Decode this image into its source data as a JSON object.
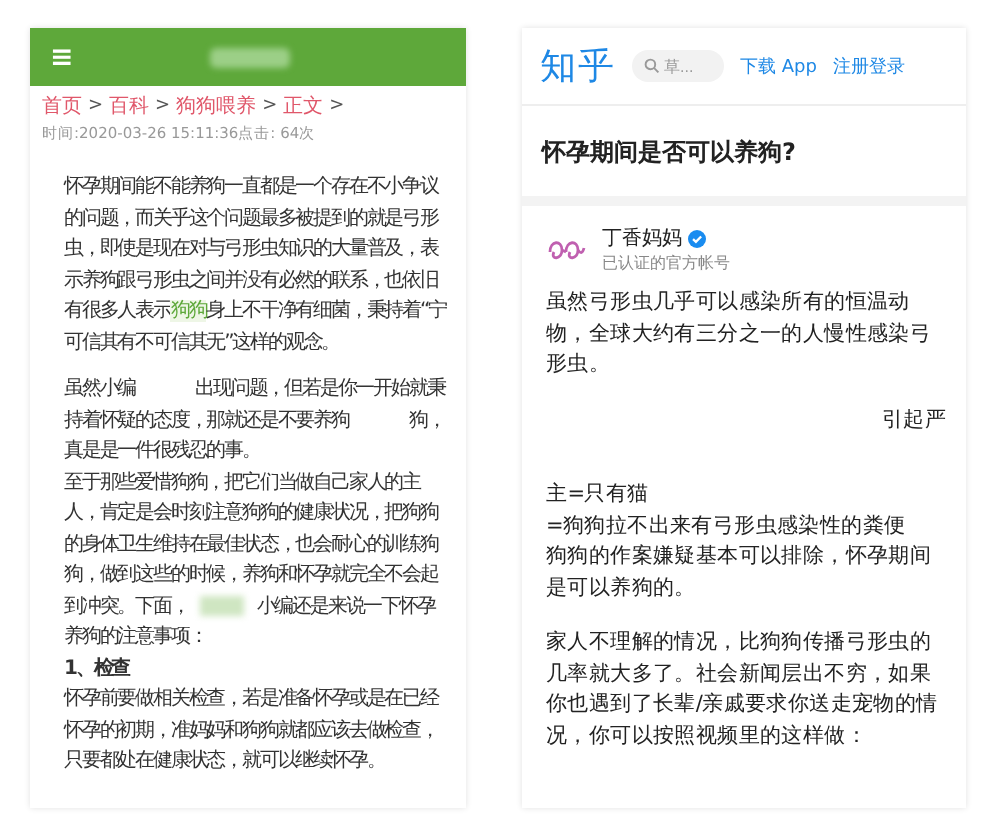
{
  "left_page": {
    "header": {
      "menu_icon": "≡"
    },
    "breadcrumb": [
      "首页",
      "百科",
      "狗狗喂养",
      "正文"
    ],
    "separator": ">",
    "meta": "时间:2020-03-26 15:11:36点击: 64次",
    "paragraphs": [
      {
        "kind": "text",
        "segments": [
          {
            "kind": "plain",
            "text": "怀孕期间能不能养狗一直都是一个存在不小争议的问题，而关乎这个问题最多被提到的就是弓形虫，即使是现在对与弓形虫知识的大量普及，表示养狗跟弓形虫之间并没有必然的联系，也依旧有很多人表示"
          },
          {
            "kind": "link",
            "text": "狗狗"
          },
          {
            "kind": "plain",
            "text": "身上不干净有细菌，秉持着“宁可信其有不可信其无”这样的观念。"
          }
        ]
      },
      {
        "kind": "tight",
        "segments": [
          {
            "kind": "plain",
            "text": "虽然小编"
          },
          {
            "kind": "gap"
          },
          {
            "kind": "plain",
            "text": "出现问题，但若是你一开始就秉持着怀疑的态度，那就还是不要养狗"
          },
          {
            "kind": "gap"
          },
          {
            "kind": "plain",
            "text": "狗，真是是一件很残忍的事。"
          }
        ]
      },
      {
        "kind": "tight",
        "segments": [
          {
            "kind": "plain",
            "text": "至于那些爱惜狗狗，把它们当做自己家人的主人，肯定是会时刻注意狗狗的健康状况，把狗狗的身体卫生维持在最佳状态，也会耐心的训练狗狗，做到这些的时候，养狗和怀孕就完全不会起到冲突。下面，"
          },
          {
            "kind": "blurred"
          },
          {
            "kind": "plain",
            "text": "小编还是来说一下怀孕养狗的注意事项："
          }
        ]
      },
      {
        "kind": "heading",
        "segments": [
          {
            "kind": "plain",
            "text": "1、检查"
          }
        ]
      },
      {
        "kind": "tight",
        "segments": [
          {
            "kind": "plain",
            "text": "怀孕前要做相关检查，若是准备怀孕或是在已经怀孕的初期，准妈妈和狗狗就都应该去做检查，只要都处在健康状态，就可以继续怀孕。"
          }
        ]
      }
    ]
  },
  "right_page": {
    "logo": "知乎",
    "search": {
      "placeholder": "草..."
    },
    "links": [
      "下载 App",
      "注册登录"
    ],
    "question": "怀孕期间是否可以养狗?",
    "author": {
      "name": "丁香妈妈",
      "verified": true,
      "subtitle": "已认证的官方帐号"
    },
    "paragraphs": [
      "虽然弓形虫几乎可以感染所有的恒温动物，全球大约有三分之一的人慢性感染弓形虫。",
      "引起严",
      "主=只有猫",
      "=狗狗拉不出来有弓形虫感染性的粪便",
      "狗狗的作案嫌疑基本可以排除，怀孕期间是可以养狗的。",
      "家人不理解的情况，比狗狗传播弓形虫的几率就大多了。社会新闻层出不穷，如果你也遇到了长辈/亲戚要求你送走宠物的情况，你可以按照视频里的这样做："
    ]
  }
}
